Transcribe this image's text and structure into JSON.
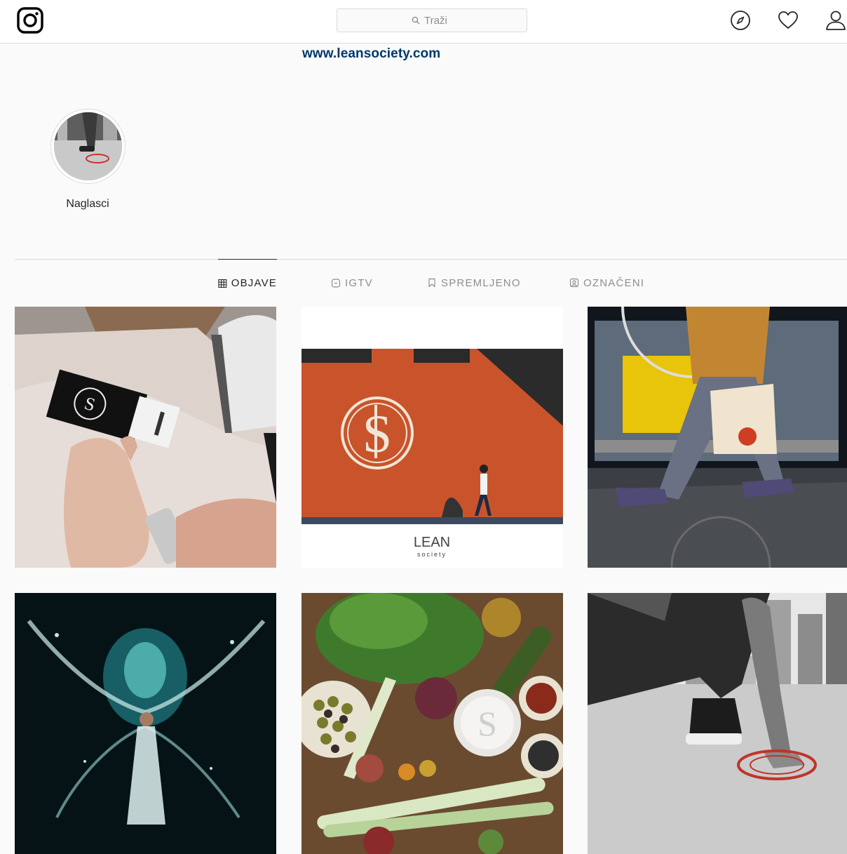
{
  "nav": {
    "search_placeholder": "Traži",
    "icons": [
      "instagram-logo",
      "search-icon",
      "explore-compass-icon",
      "heart-icon",
      "profile-icon"
    ]
  },
  "profile": {
    "website": "www.leansociety.com",
    "highlights": [
      {
        "label": "Naglasci"
      }
    ]
  },
  "tabs": [
    {
      "label": "OBJAVE",
      "icon": "grid-icon",
      "active": true
    },
    {
      "label": "IGTV",
      "icon": "igtv-icon",
      "active": false
    },
    {
      "label": "SPREMLJENO",
      "icon": "bookmark-icon",
      "active": false
    },
    {
      "label": "OZNAČENI",
      "icon": "tagged-icon",
      "active": false
    }
  ],
  "posts": [
    {
      "subject": "hand holding clothing tag with logo",
      "logo_text": ""
    },
    {
      "subject": "orange brick wall with logo and walking person",
      "logo_text": "LEAN",
      "logo_subtext": "society"
    },
    {
      "subject": "person walking with shopping bag"
    },
    {
      "subject": "water splash around person"
    },
    {
      "subject": "vegetables and olives on table"
    },
    {
      "subject": "runner hand on rooftop with logo"
    }
  ],
  "colors": {
    "accent_link": "#00376b",
    "border": "#dbdbdb",
    "background": "#fafafa"
  }
}
